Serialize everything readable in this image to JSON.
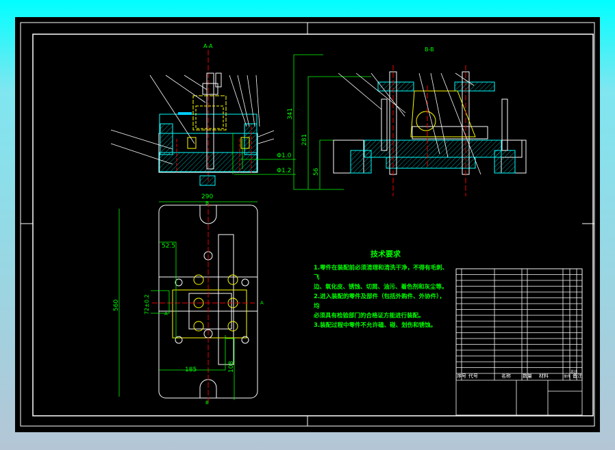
{
  "views": {
    "section_a_label": "A-A",
    "section_b_label": "B-B",
    "dims_front": {
      "d1": "Φ1.0",
      "d2": "Φ1.2"
    },
    "dims_side": {
      "h_total": "341",
      "h_mid": "281",
      "h_base": "56"
    },
    "dims_plan": {
      "width": "290",
      "height": "560",
      "offset": "52.5",
      "tol": "72±0.2",
      "x": "185",
      "y": "108",
      "cut_a": "A",
      "cut_b": "B"
    }
  },
  "tech_requirements": {
    "title": "技术要求",
    "lines": [
      "1.零件在装配前必须清理和清洗干净，不得有毛刺、飞",
      "边、氧化皮、锈蚀、切屑、油污、着色剂和灰尘等。",
      "2.进入装配的零件及部件（包括外购件、外协件），均",
      "必须具有检验部门的合格证方能进行装配。",
      "3.装配过程中零件不允许磕、碰、划伤和锈蚀。"
    ]
  },
  "title_block": {
    "headers": [
      "序号",
      "代号",
      "名称",
      "数量",
      "材料",
      "单件",
      "总计",
      "备注"
    ]
  }
}
